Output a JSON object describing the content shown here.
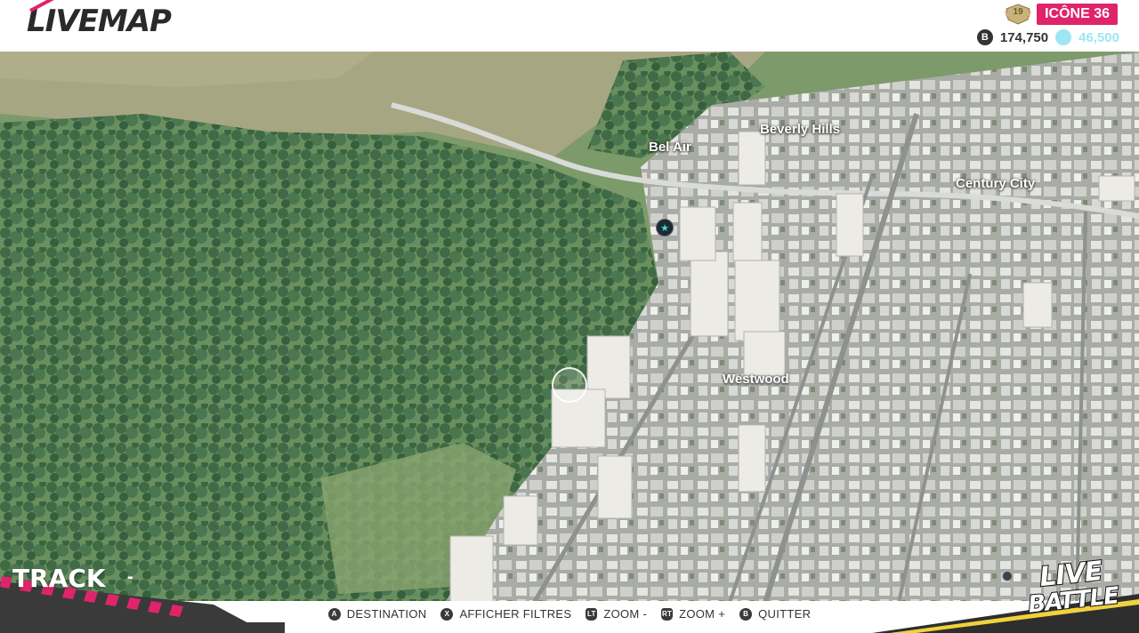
{
  "header": {
    "logo_text": "LIVEMAP",
    "rank_number": "19",
    "rank_label": "ICÔNE 36",
    "money_icon": "bucks-coin-icon",
    "money_value": "174,750",
    "crew_value": "46,500"
  },
  "map": {
    "districts": [
      {
        "name": "Bel Air"
      },
      {
        "name": "Beverly Hills"
      },
      {
        "name": "Century City"
      },
      {
        "name": "Westwood"
      }
    ],
    "poi_icon": "star-icon"
  },
  "track": {
    "label": "TRACK",
    "dash": "-"
  },
  "hints": [
    {
      "button": "A",
      "label": "DESTINATION"
    },
    {
      "button": "X",
      "label": "AFFICHER FILTRES"
    },
    {
      "button": "LT",
      "label": "ZOOM -"
    },
    {
      "button": "RT",
      "label": "ZOOM +"
    },
    {
      "button": "B",
      "label": "QUITTER"
    }
  ],
  "branding": {
    "line1": "LIVE",
    "line2": "BATTLE"
  },
  "colors": {
    "accent_pink": "#e0246b",
    "crew_cyan": "#9fe6f3",
    "track_yellow": "#f0d23c"
  }
}
